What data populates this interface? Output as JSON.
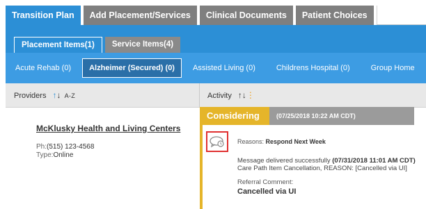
{
  "top_tabs": [
    {
      "label": "Transition Plan",
      "active": true
    },
    {
      "label": "Add Placement/Services",
      "active": false
    },
    {
      "label": "Clinical Documents",
      "active": false
    },
    {
      "label": "Patient Choices",
      "active": false
    }
  ],
  "sub_tabs": [
    {
      "label": "Placement Items(1)",
      "active": true
    },
    {
      "label": "Service Items(4)",
      "active": false
    }
  ],
  "categories": [
    {
      "label": "Acute Rehab (0)",
      "selected": false
    },
    {
      "label": "Alzheimer (Secured) (0)",
      "selected": true
    },
    {
      "label": "Assisted Living (0)",
      "selected": false
    },
    {
      "label": "Childrens Hospital (0)",
      "selected": false
    },
    {
      "label": "Group Home",
      "selected": false
    }
  ],
  "columns": {
    "providers_label": "Providers",
    "providers_sort": "A-Z",
    "activity_label": "Activity"
  },
  "provider": {
    "name": "McKlusky Health and Living Centers",
    "phone_label": "Ph:",
    "phone": "(515) 123-4568",
    "type_label": "Type:",
    "type": "Online"
  },
  "activity": {
    "status": "Considering",
    "status_date": "(07/25/2018 10:22 AM CDT)",
    "reasons_label": "Reasons:",
    "reasons_value": "Respond Next Week",
    "message_prefix": "Message delivered successfully",
    "message_time": "(07/31/2018 11:01 AM CDT)",
    "cancellation": "Care Path Item Cancellation, REASON: [Cancelled via UI]",
    "referral_label": "Referral Comment:",
    "referral_value": "Cancelled via UI"
  },
  "colors": {
    "primary_blue": "#2c8fd6",
    "status_gold": "#e5b52a",
    "highlight_red": "#e03030"
  }
}
